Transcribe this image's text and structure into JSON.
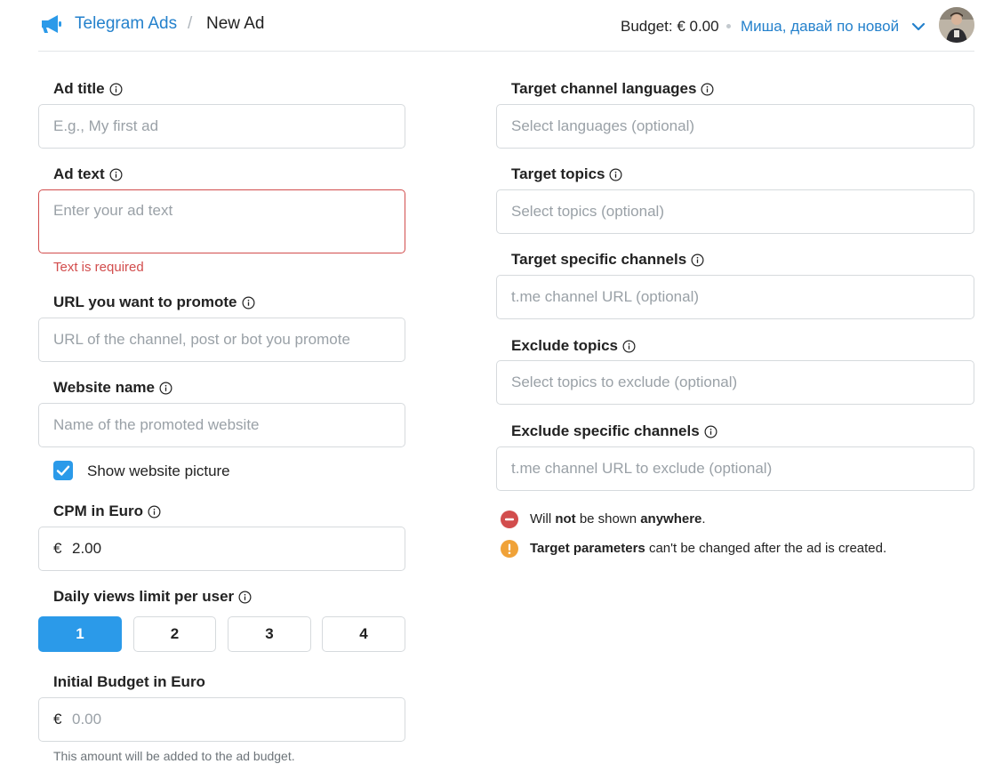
{
  "header": {
    "app_name": "Telegram Ads",
    "separator": "/",
    "current_page": "New Ad",
    "budget": "Budget: € 0.00",
    "account_name": "Миша, давай по новой"
  },
  "left": {
    "ad_title": {
      "label": "Ad title",
      "placeholder": "E.g., My first ad"
    },
    "ad_text": {
      "label": "Ad text",
      "placeholder": "Enter your ad text",
      "error": "Text is required"
    },
    "url": {
      "label": "URL you want to promote",
      "placeholder": "URL of the channel, post or bot you promote"
    },
    "website_name": {
      "label": "Website name",
      "placeholder": "Name of the promoted website"
    },
    "show_picture": {
      "label": "Show website picture",
      "checked": true
    },
    "cpm": {
      "label": "CPM in Euro",
      "currency": "€",
      "value": "2.00"
    },
    "daily_views": {
      "label": "Daily views limit per user",
      "options": [
        "1",
        "2",
        "3",
        "4"
      ],
      "selected": "1"
    },
    "initial_budget": {
      "label": "Initial Budget in Euro",
      "currency": "€",
      "placeholder": "0.00",
      "hint": "This amount will be added to the ad budget."
    }
  },
  "right": {
    "languages": {
      "label": "Target channel languages",
      "placeholder": "Select languages (optional)"
    },
    "topics": {
      "label": "Target topics",
      "placeholder": "Select topics (optional)"
    },
    "channels": {
      "label": "Target specific channels",
      "placeholder": "t.me channel URL (optional)"
    },
    "exclude_topics": {
      "label": "Exclude topics",
      "placeholder": "Select topics to exclude (optional)"
    },
    "exclude_channels": {
      "label": "Exclude specific channels",
      "placeholder": "t.me channel URL to exclude (optional)"
    },
    "notes": {
      "shown_1": "Will ",
      "shown_2": "not",
      "shown_3": " be shown ",
      "shown_4": "anywhere",
      "shown_5": ".",
      "params_1": "Target parameters",
      "params_2": " can't be changed after the ad is created."
    }
  },
  "colors": {
    "accent": "#2481cc",
    "primary_button": "#2b9ae9",
    "error": "#d24d4d",
    "warning": "#f0a238"
  },
  "icons": [
    "megaphone-icon",
    "chevron-down-icon",
    "info-icon",
    "checkmark-icon",
    "minus-circle-icon",
    "exclamation-icon"
  ]
}
